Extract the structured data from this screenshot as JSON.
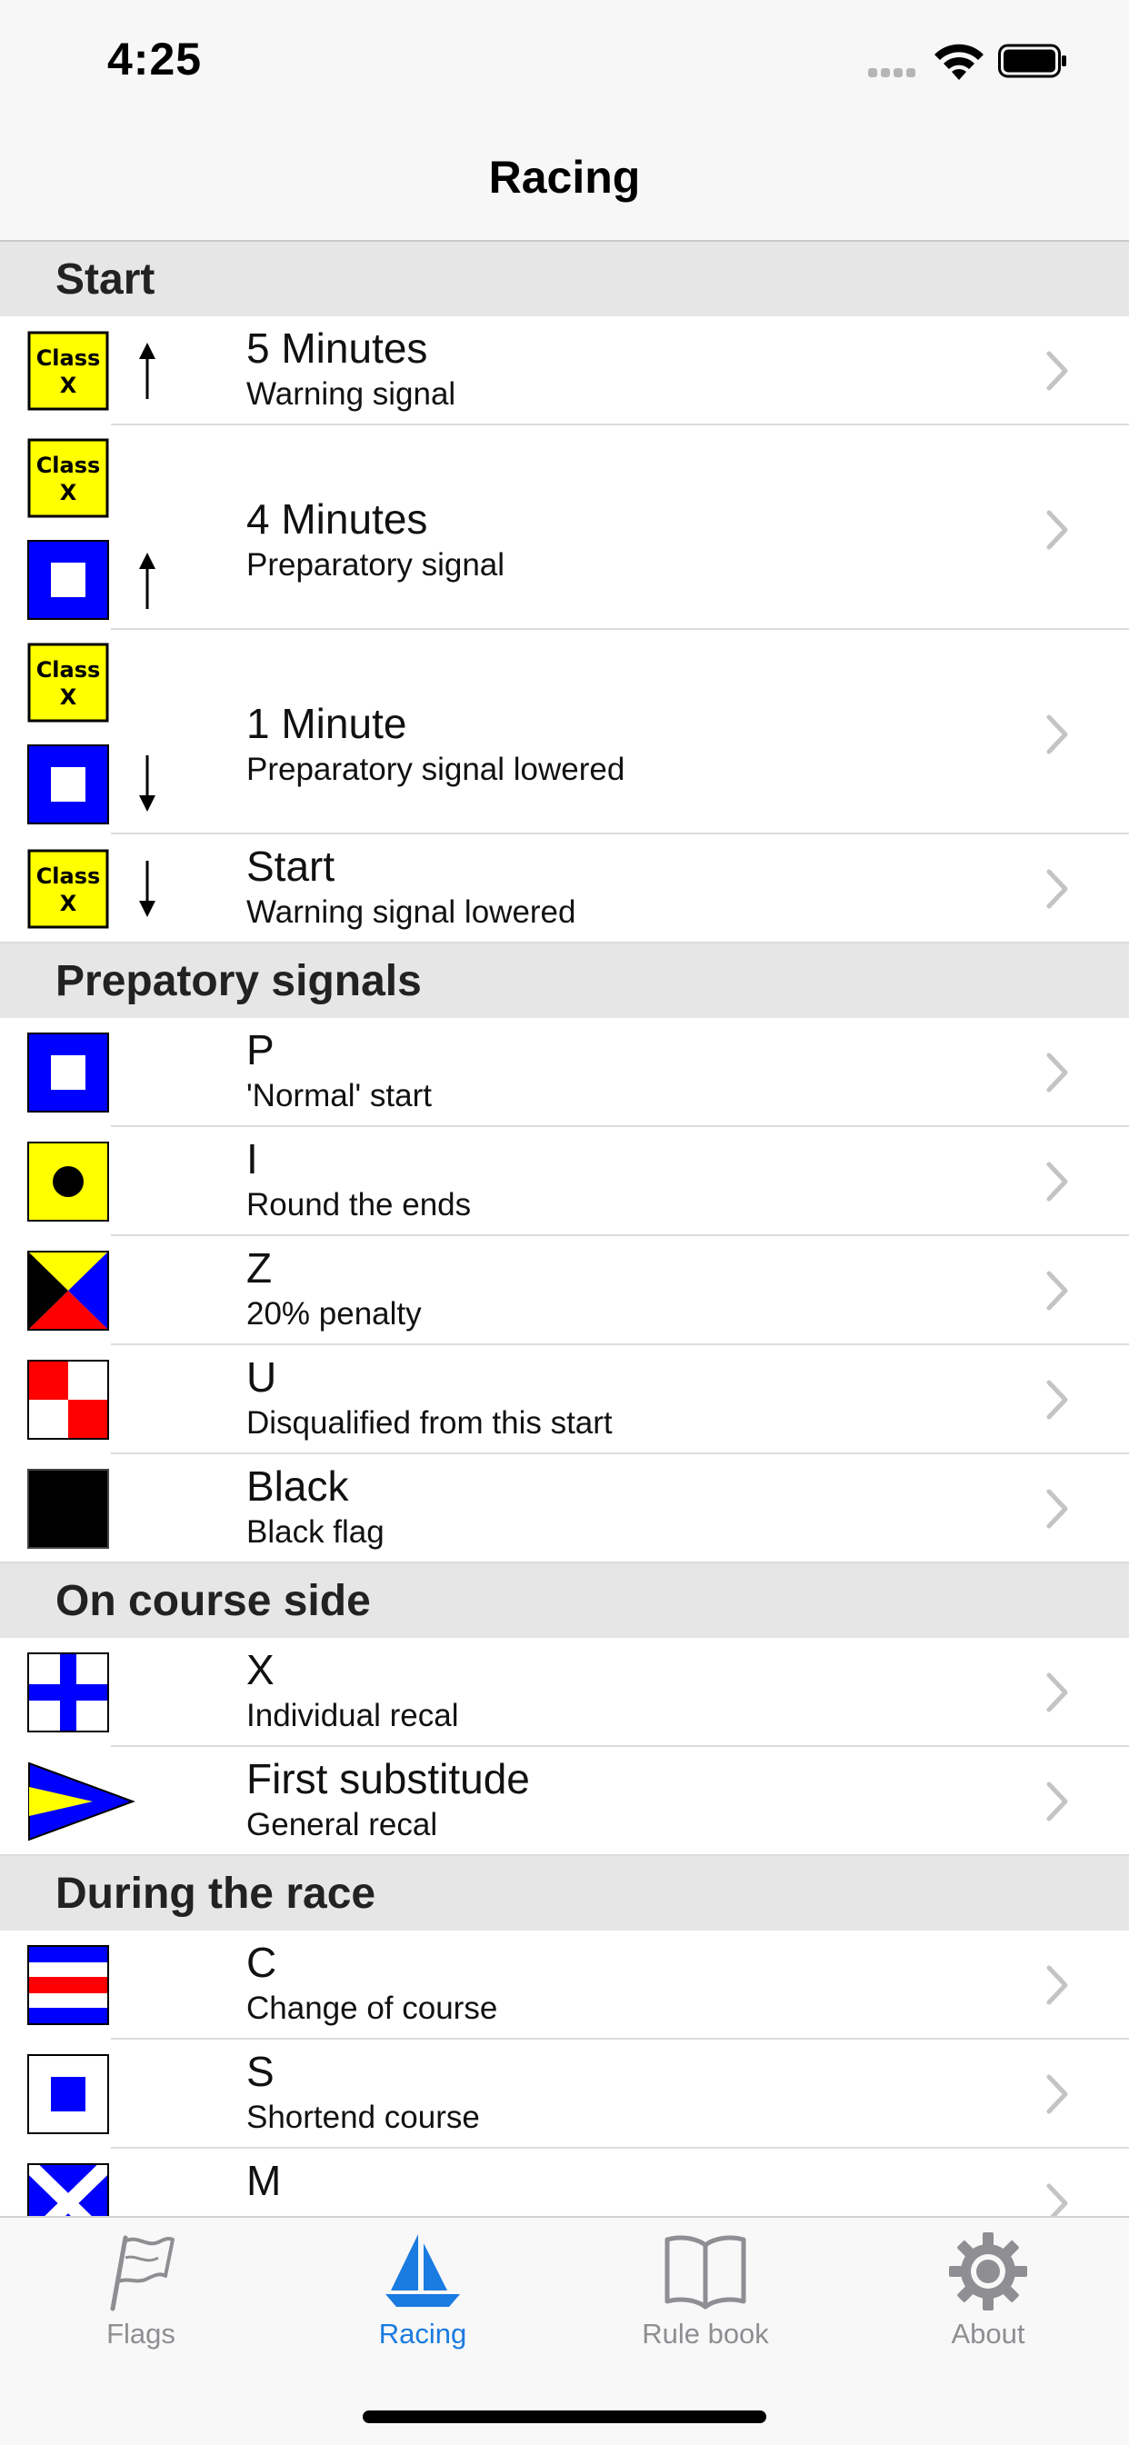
{
  "status_bar": {
    "time": "4:25"
  },
  "nav": {
    "title": "Racing"
  },
  "colors": {
    "accent": "#1a7be0",
    "flag_yellow": "#ffff00",
    "flag_blue": "#0000ff",
    "flag_red": "#ff0000",
    "tab_inactive": "#8e8e93",
    "section_bg": "#e6e6e6"
  },
  "sections": [
    {
      "title": "Start"
    },
    {
      "title": "Prepatory signals"
    },
    {
      "title": "On course side"
    },
    {
      "title": "During the race"
    }
  ],
  "flag_label": {
    "line1": "Class",
    "line2": "X"
  },
  "rows": [
    {
      "title": "5 Minutes",
      "subtitle": "Warning signal",
      "flags": [
        "class-x"
      ],
      "arrow": "up"
    },
    {
      "title": "4 Minutes",
      "subtitle": "Preparatory signal",
      "flags": [
        "class-x",
        "p"
      ],
      "arrow": "up"
    },
    {
      "title": "1 Minute",
      "subtitle": "Preparatory signal lowered",
      "flags": [
        "class-x",
        "p"
      ],
      "arrow": "down"
    },
    {
      "title": "Start",
      "subtitle": "Warning signal lowered",
      "flags": [
        "class-x"
      ],
      "arrow": "down"
    },
    {
      "title": "P",
      "subtitle": "'Normal' start",
      "flags": [
        "p"
      ]
    },
    {
      "title": "I",
      "subtitle": "Round the ends",
      "flags": [
        "i"
      ]
    },
    {
      "title": "Z",
      "subtitle": "20% penalty",
      "flags": [
        "z"
      ]
    },
    {
      "title": "U",
      "subtitle": "Disqualified from this start",
      "flags": [
        "u"
      ]
    },
    {
      "title": "Black",
      "subtitle": "Black flag",
      "flags": [
        "black"
      ]
    },
    {
      "title": "X",
      "subtitle": "Individual recal",
      "flags": [
        "x"
      ]
    },
    {
      "title": "First substitude",
      "subtitle": "General recal",
      "flags": [
        "first-substitute"
      ]
    },
    {
      "title": "C",
      "subtitle": "Change of course",
      "flags": [
        "c"
      ]
    },
    {
      "title": "S",
      "subtitle": "Shortend course",
      "flags": [
        "s"
      ]
    },
    {
      "title": "M",
      "subtitle": "",
      "flags": [
        "m"
      ]
    }
  ],
  "tabs": [
    {
      "label": "Flags",
      "icon": "flag-icon",
      "active": false
    },
    {
      "label": "Racing",
      "icon": "sailboat-icon",
      "active": true
    },
    {
      "label": "Rule book",
      "icon": "book-icon",
      "active": false
    },
    {
      "label": "About",
      "icon": "gear-icon",
      "active": false
    }
  ]
}
